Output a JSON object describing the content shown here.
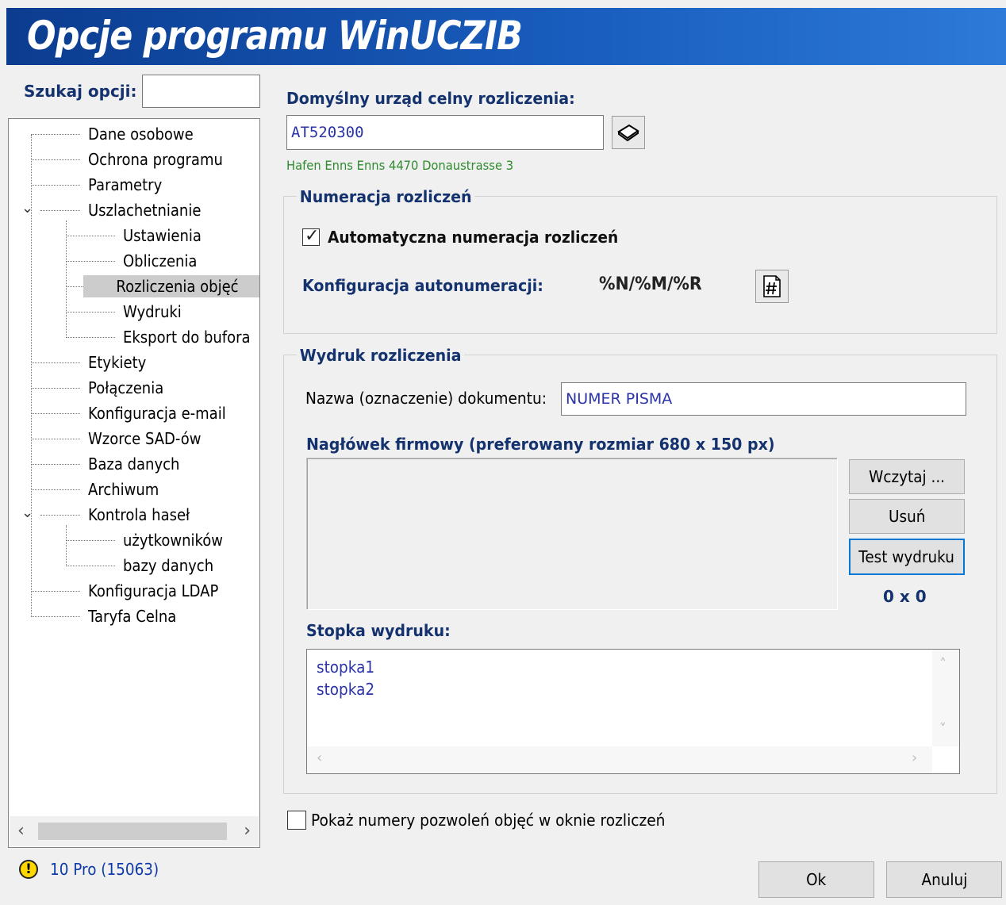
{
  "window": {
    "title": "Opcje programu WinUCZIB"
  },
  "search": {
    "label": "Szukaj opcji:",
    "value": ""
  },
  "tree": {
    "items": [
      {
        "label": "Dane osobowe"
      },
      {
        "label": "Ochrona programu"
      },
      {
        "label": "Parametry"
      },
      {
        "label": "Uszlachetnianie"
      },
      {
        "label": "Ustawienia"
      },
      {
        "label": "Obliczenia"
      },
      {
        "label": "Rozliczenia objęć"
      },
      {
        "label": "Wydruki"
      },
      {
        "label": "Eksport do bufora"
      },
      {
        "label": "Etykiety"
      },
      {
        "label": "Połączenia"
      },
      {
        "label": "Konfiguracja e-mail"
      },
      {
        "label": "Wzorce SAD-ów"
      },
      {
        "label": "Baza danych"
      },
      {
        "label": "Archiwum"
      },
      {
        "label": "Kontrola haseł"
      },
      {
        "label": "użytkowników"
      },
      {
        "label": "bazy danych"
      },
      {
        "label": "Konfiguracja LDAP"
      },
      {
        "label": "Taryfa Celna"
      }
    ]
  },
  "status": {
    "icon": "warning-icon",
    "text": "10 Pro (15063)"
  },
  "customs": {
    "label": "Domyślny urząd celny rozliczenia:",
    "value": "AT520300",
    "lookup_icon": "book-icon",
    "address": "Hafen Enns Enns 4470 Donaustrasse 3"
  },
  "numbering": {
    "title": "Numeracja rozliczeń",
    "auto_label": "Automatyczna numeracja rozliczeń",
    "auto_checked": true,
    "config_label": "Konfiguracja autonumeracji:",
    "config_value": "%N/%M/%R",
    "config_icon": "hash-document-icon"
  },
  "print": {
    "title": "Wydruk rozliczenia",
    "doc_name_label": "Nazwa (oznaczenie) dokumentu:",
    "doc_name_value": "NUMER PISMA",
    "header_label": "Nagłówek firmowy (preferowany rozmiar 680 x 150 px)",
    "load_button": "Wczytaj ...",
    "delete_button": "Usuń",
    "test_button": "Test wydruku",
    "dimensions": "0 x 0",
    "footer_label": "Stopka wydruku:",
    "footer_lines": [
      "stopka1",
      "stopka2"
    ]
  },
  "permits": {
    "label": "Pokaż numery pozwoleń objęć w oknie rozliczeń",
    "checked": false
  },
  "dialog": {
    "ok": "Ok",
    "cancel": "Anuluj"
  }
}
